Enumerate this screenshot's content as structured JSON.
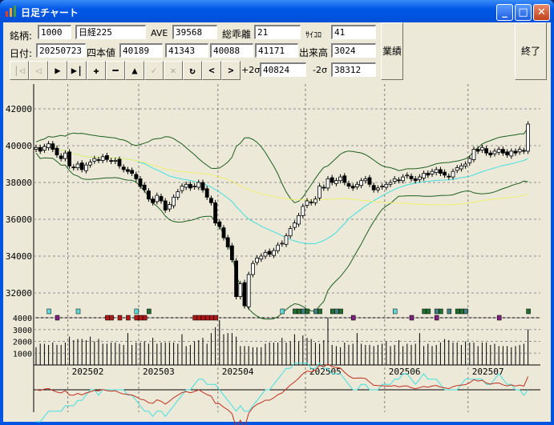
{
  "window": {
    "title": "日足チャート",
    "minimize": "_",
    "maximize": "□",
    "close": "✕"
  },
  "info": {
    "code_label": "銘柄:",
    "code": "1000",
    "name": "日経225",
    "ave_label": "AVE",
    "ave": "39568",
    "dev_label": "総乖離",
    "dev": "21",
    "psy_label": "ｻｲｺﾛ",
    "psy": "41",
    "date_label": "日付:",
    "date": "20250723",
    "ohlc_label": "四本値",
    "open": "40189",
    "high": "41343",
    "low": "40088",
    "close": "41171",
    "vol_label": "出来高",
    "volume": "3024",
    "p2s_label": "+2σ",
    "p2s": "40824",
    "m2s_label": "-2σ",
    "m2s": "38312"
  },
  "buttons": {
    "results": "業績",
    "exit": "終了"
  },
  "toolbar": [
    {
      "name": "first",
      "glyph": "|◁",
      "enabled": false
    },
    {
      "name": "prev",
      "glyph": "◁",
      "enabled": false
    },
    {
      "name": "play",
      "glyph": "▶",
      "enabled": true
    },
    {
      "name": "last",
      "glyph": "▶|",
      "enabled": true
    },
    {
      "name": "plus",
      "glyph": "✚",
      "enabled": true
    },
    {
      "name": "minus",
      "glyph": "━",
      "enabled": true
    },
    {
      "name": "up",
      "glyph": "▲",
      "enabled": true
    },
    {
      "name": "check",
      "glyph": "✓",
      "enabled": false
    },
    {
      "name": "cancel",
      "glyph": "✕",
      "enabled": false
    },
    {
      "name": "refresh",
      "glyph": "↻",
      "enabled": true
    },
    {
      "name": "scroll-left",
      "glyph": "<",
      "enabled": true
    },
    {
      "name": "scroll-right",
      "glyph": ">",
      "enabled": true
    }
  ],
  "chart_data": {
    "type": "candlestick",
    "price_ticks": [
      "42000",
      "40000",
      "38000",
      "36000",
      "34000",
      "32000"
    ],
    "price_tick_values": [
      42000,
      40000,
      38000,
      36000,
      34000,
      32000
    ],
    "volume_ticks": [
      "4000",
      "3000",
      "2000",
      "1000"
    ],
    "volume_tick_values": [
      4000,
      3000,
      2000,
      1000
    ],
    "months": [
      "202502",
      "202503",
      "202504",
      "202505",
      "202506",
      "202507"
    ],
    "month_start_index": [
      8,
      25,
      44,
      65,
      84,
      104
    ],
    "closes": [
      39900,
      39700,
      39950,
      40100,
      39800,
      39500,
      39300,
      39600,
      38900,
      38800,
      39000,
      38700,
      38950,
      39100,
      39300,
      39200,
      39400,
      39250,
      39150,
      39200,
      38900,
      38700,
      38600,
      38500,
      38200,
      37800,
      37600,
      37100,
      36900,
      37300,
      37000,
      36500,
      36800,
      37200,
      37500,
      37800,
      37900,
      37700,
      37800,
      38000,
      37600,
      37200,
      36900,
      35800,
      35600,
      35000,
      34500,
      33800,
      31800,
      32500,
      31300,
      33000,
      33600,
      33900,
      34000,
      34200,
      34100,
      34300,
      34600,
      34700,
      35100,
      35500,
      35800,
      36200,
      36700,
      37000,
      36900,
      37100,
      37800,
      37700,
      38200,
      38000,
      38100,
      38300,
      38000,
      37800,
      37700,
      37900,
      38100,
      38200,
      37900,
      37600,
      37700,
      37800,
      37900,
      38000,
      38200,
      38100,
      38300,
      38400,
      38200,
      38100,
      38300,
      38500,
      38400,
      38600,
      38700,
      38500,
      38400,
      38300,
      38600,
      38800,
      38900,
      39000,
      39300,
      39800,
      39700,
      39900,
      39600,
      39500,
      39700,
      39800,
      39600,
      39500,
      39700,
      39600,
      39800,
      39700,
      41171
    ],
    "volumes": [
      1500,
      1800,
      1800,
      1700,
      1900,
      1700,
      1700,
      1900,
      2400,
      2100,
      2200,
      2200,
      2100,
      2400,
      2000,
      2200,
      1800,
      1800,
      1900,
      1900,
      1800,
      1700,
      2700,
      1700,
      1900,
      1900,
      2000,
      1800,
      2300,
      1800,
      1900,
      1900,
      1900,
      1900,
      1800,
      2600,
      1600,
      1700,
      2000,
      2100,
      2300,
      1800,
      2700,
      3200,
      3800,
      2600,
      2700,
      2700,
      2400,
      1600,
      1600,
      1600,
      1500,
      1500,
      1500,
      1800,
      1900,
      1900,
      1900,
      2300,
      1900,
      2000,
      2600,
      2000,
      2500,
      2300,
      2200,
      1900,
      1800,
      2100,
      4000,
      1700,
      1600,
      1500,
      1900,
      1700,
      1800,
      2700,
      1800,
      1700,
      1700,
      1600,
      1700,
      1800,
      2000,
      1600,
      1700,
      2100,
      1600,
      1800,
      1700,
      1800,
      2700,
      1600,
      1800,
      1600,
      1700,
      1900,
      2200,
      2100,
      1900,
      1900,
      1700,
      2000,
      1900,
      1900,
      1600,
      1900,
      1900,
      1700,
      1800,
      1600,
      1600,
      1600,
      1500,
      1600,
      1700,
      1800,
      3024
    ],
    "signals": [
      {
        "i": 3,
        "c": "#5fd7d7"
      },
      {
        "i": 10,
        "c": "#5fd7d7"
      },
      {
        "i": 24,
        "c": "#5fd7d7"
      },
      {
        "i": 27,
        "c": "#1f6f2f"
      },
      {
        "i": 59,
        "c": "#5fd7d7"
      },
      {
        "i": 62,
        "c": "#1f6f2f"
      },
      {
        "i": 63,
        "c": "#1f6f2f"
      },
      {
        "i": 64,
        "c": "#3f7f7f"
      },
      {
        "i": 65,
        "c": "#1f6f2f"
      },
      {
        "i": 67,
        "c": "#3f7f7f"
      },
      {
        "i": 68,
        "c": "#1f6f2f"
      },
      {
        "i": 71,
        "c": "#1f6f2f"
      },
      {
        "i": 72,
        "c": "#3f7f7f"
      },
      {
        "i": 73,
        "c": "#1f6f2f"
      },
      {
        "i": 86,
        "c": "#5fd7d7"
      },
      {
        "i": 93,
        "c": "#1f6f2f"
      },
      {
        "i": 94,
        "c": "#1f6f2f"
      },
      {
        "i": 96,
        "c": "#3f7f7f"
      },
      {
        "i": 97,
        "c": "#1f6f2f"
      },
      {
        "i": 99,
        "c": "#3f7f7f"
      },
      {
        "i": 101,
        "c": "#1f6f2f"
      },
      {
        "i": 102,
        "c": "#1f6f2f"
      },
      {
        "i": 103,
        "c": "#3f7f7f"
      },
      {
        "i": 118,
        "c": "#1f6f2f"
      }
    ],
    "sell_signals": [
      {
        "i": 5,
        "c": "#7f1f7f"
      },
      {
        "i": 17,
        "c": "#b01818"
      },
      {
        "i": 18,
        "c": "#b01818"
      },
      {
        "i": 20,
        "c": "#b01818"
      },
      {
        "i": 22,
        "c": "#b01818"
      },
      {
        "i": 24,
        "c": "#b01818"
      },
      {
        "i": 25,
        "c": "#b01818"
      },
      {
        "i": 26,
        "c": "#b01818"
      },
      {
        "i": 38,
        "c": "#b01818"
      },
      {
        "i": 39,
        "c": "#b01818"
      },
      {
        "i": 40,
        "c": "#b01818"
      },
      {
        "i": 41,
        "c": "#b01818"
      },
      {
        "i": 42,
        "c": "#b01818"
      },
      {
        "i": 43,
        "c": "#b01818"
      },
      {
        "i": 76,
        "c": "#7f1f7f"
      },
      {
        "i": 90,
        "c": "#7f1f7f"
      },
      {
        "i": 96,
        "c": "#7f1f7f"
      },
      {
        "i": 111,
        "c": "#7f1f7f"
      }
    ],
    "colors": {
      "band": "#1f5f1f",
      "ma_short": "#40e0e0",
      "ma_long": "#f0f070",
      "osc1": "#40e0e0",
      "osc2": "#c03020",
      "grid": "#808080"
    }
  }
}
